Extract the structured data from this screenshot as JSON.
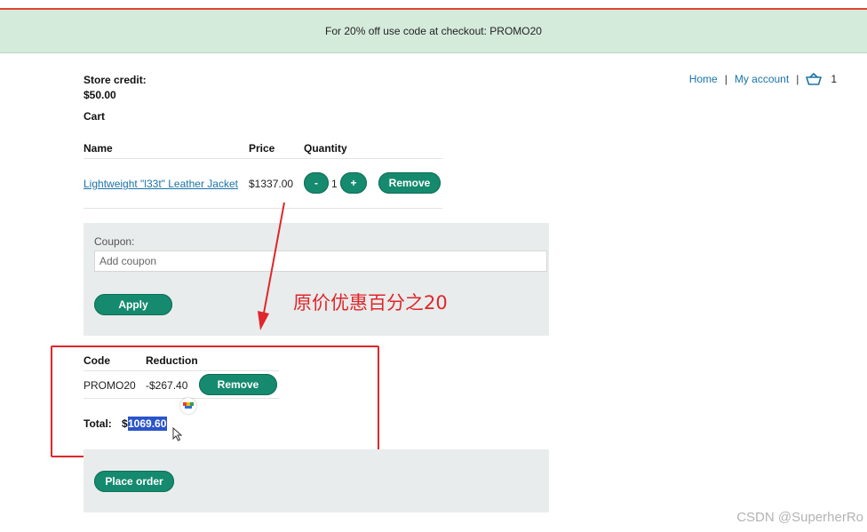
{
  "banner": {
    "text": "For 20% off use code at checkout: PROMO20"
  },
  "nav": {
    "home": "Home",
    "separator": "|",
    "my_account": "My account",
    "cart_count": "1"
  },
  "store_credit": {
    "label": "Store credit:",
    "value": "$50.00"
  },
  "cart": {
    "title": "Cart",
    "columns": {
      "name": "Name",
      "price": "Price",
      "quantity": "Quantity"
    },
    "items": [
      {
        "name": "Lightweight \"l33t\" Leather Jacket",
        "price": "$1337.00",
        "minus": "-",
        "quantity": "1",
        "plus": "+",
        "remove": "Remove"
      }
    ]
  },
  "coupon": {
    "label": "Coupon:",
    "placeholder": "Add coupon",
    "apply": "Apply"
  },
  "annotation": {
    "text": "原价优惠百分之20"
  },
  "applied_coupons": {
    "columns": {
      "code": "Code",
      "reduction": "Reduction"
    },
    "rows": [
      {
        "code": "PROMO20",
        "reduction": "-$267.40",
        "remove": "Remove"
      }
    ]
  },
  "total": {
    "label": "Total:",
    "currency": "$",
    "value": "1069.60"
  },
  "order": {
    "place_order": "Place order"
  },
  "watermark": "CSDN @SuperherRo",
  "colors": {
    "accent_green": "#158a6e",
    "banner_bg": "#d4ebdb",
    "panel_bg": "#e8ecec",
    "link": "#1a73a8",
    "annotation_red": "#e0262a",
    "selection": "#2a55c9"
  }
}
